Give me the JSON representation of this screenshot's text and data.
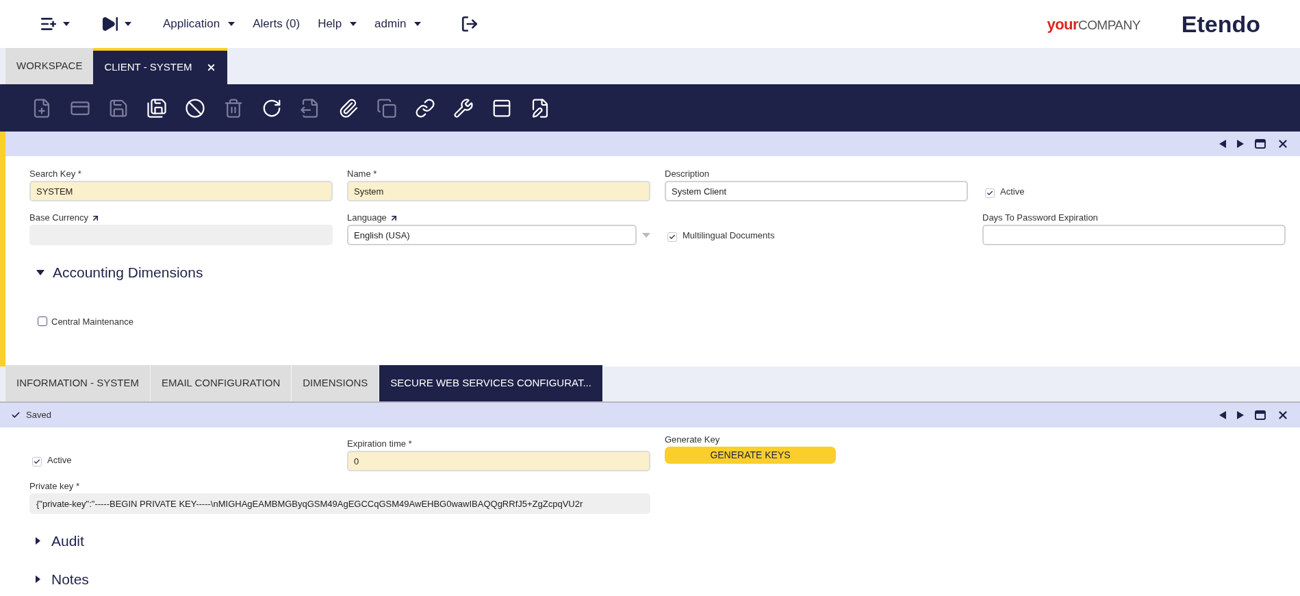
{
  "top_menu": [
    {
      "kind": "icon"
    },
    {
      "kind": "icon"
    },
    {
      "kind": "menu",
      "label": "Application"
    },
    {
      "kind": "plain",
      "label": "Alerts (0)"
    },
    {
      "kind": "menu",
      "label": "Help"
    },
    {
      "kind": "menu",
      "label": "admin"
    },
    {
      "kind": "logout"
    }
  ],
  "logo": {
    "accent": "your",
    "rest": "COMPANY",
    "brand": "Etendo"
  },
  "main_tabs": [
    {
      "label": "WORKSPACE",
      "selected": false,
      "closable": false
    },
    {
      "label": "CLIENT - SYSTEM",
      "selected": true,
      "closable": true
    }
  ],
  "toolbar": [
    {
      "disabled": true
    },
    {
      "disabled": true
    },
    {
      "disabled": true
    },
    {
      "disabled": false
    },
    {
      "disabled": false
    },
    {
      "disabled": true
    },
    {
      "disabled": false
    },
    {
      "disabled": true
    },
    {
      "disabled": false
    },
    {
      "disabled": true
    },
    {
      "disabled": false
    },
    {
      "disabled": false
    },
    {
      "disabled": false
    },
    {
      "disabled": false
    }
  ],
  "header_form": {
    "rows": [
      [
        {
          "kind": "text",
          "label": "Search Key *",
          "value": "SYSTEM",
          "required": true
        },
        {
          "kind": "text",
          "label": "Name *",
          "value": "System",
          "required": true
        },
        {
          "kind": "text",
          "label": "Description",
          "value": "System Client",
          "required": false
        },
        {
          "kind": "checkbox",
          "label": "Active",
          "checked": true
        }
      ],
      [
        {
          "kind": "readonly",
          "label": "Base Currency",
          "linked": true
        },
        {
          "kind": "select",
          "label": "Language",
          "value": "English (USA)",
          "linked": true
        },
        {
          "kind": "checkbox",
          "label": "Multilingual Documents",
          "checked": true
        },
        {
          "kind": "text",
          "label": "Days To Password Expiration",
          "required": false
        }
      ]
    ],
    "section": {
      "title": "Accounting Dimensions",
      "expanded": true
    },
    "extra_checkbox": {
      "label": "Central Maintenance",
      "checked": false
    }
  },
  "sub_tabs": [
    {
      "label": "INFORMATION - SYSTEM",
      "selected": false
    },
    {
      "label": "EMAIL CONFIGURATION",
      "selected": false
    },
    {
      "label": "DIMENSIONS",
      "selected": false
    },
    {
      "label": "SECURE WEB SERVICES CONFIGURAT...",
      "selected": true
    }
  ],
  "status": "Saved",
  "sub_form": {
    "active": {
      "label": "Active",
      "checked": true
    },
    "expiration": {
      "label": "Expiration time *",
      "value": "0",
      "required": true
    },
    "generate": {
      "label": "Generate Key",
      "button": "GENERATE KEYS"
    },
    "private_key": {
      "label": "Private key *",
      "value": "{\"private-key\":\"-----BEGIN PRIVATE KEY-----\\nMIGHAgEAMBMGByqGSM49AgEGCCqGSM49AwEHBG0wawIBAQQgRRfJ5+ZgZcpqVU2r"
    },
    "sections": [
      {
        "title": "Audit",
        "expanded": false
      },
      {
        "title": "Notes",
        "expanded": false
      }
    ]
  }
}
